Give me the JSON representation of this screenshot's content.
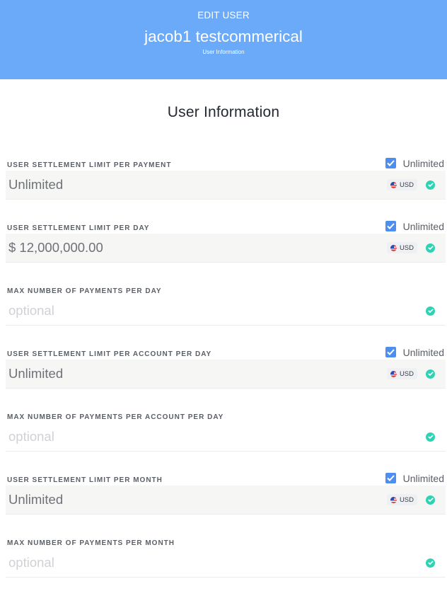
{
  "header": {
    "kicker": "EDIT USER",
    "name": "jacob1 testcommerical",
    "subtitle": "User Information"
  },
  "section_title": "User Information",
  "unlimited_label": "Unlimited",
  "currency_label": "USD",
  "fields": [
    {
      "label": "USER SETTLEMENT LIMIT PER PAYMENT",
      "value": "Unlimited",
      "placeholder": "",
      "has_unlimited": true,
      "unlimited_checked": true,
      "has_currency": true
    },
    {
      "label": "USER SETTLEMENT LIMIT PER DAY",
      "value": "$ 12,000,000.00",
      "placeholder": "",
      "has_unlimited": true,
      "unlimited_checked": true,
      "has_currency": true
    },
    {
      "label": "MAX NUMBER OF PAYMENTS PER DAY",
      "value": "",
      "placeholder": "optional",
      "has_unlimited": false,
      "has_currency": false
    },
    {
      "label": "USER SETTLEMENT LIMIT PER ACCOUNT PER DAY",
      "value": "Unlimited",
      "placeholder": "",
      "has_unlimited": true,
      "unlimited_checked": true,
      "has_currency": true
    },
    {
      "label": "MAX NUMBER OF PAYMENTS PER ACCOUNT PER DAY",
      "value": "",
      "placeholder": "optional",
      "has_unlimited": false,
      "has_currency": false
    },
    {
      "label": "USER SETTLEMENT LIMIT PER MONTH",
      "value": "Unlimited",
      "placeholder": "",
      "has_unlimited": true,
      "unlimited_checked": true,
      "has_currency": true
    },
    {
      "label": "MAX NUMBER OF PAYMENTS PER MONTH",
      "value": "",
      "placeholder": "optional",
      "has_unlimited": false,
      "has_currency": false
    }
  ],
  "colors": {
    "header_bg": "#6aaaf9",
    "checkbox": "#4d8ef0",
    "valid_check": "#2fd3b3",
    "filled_input_bg": "#f6f6f5"
  },
  "icons": {
    "unlimited_checkbox": "checkbox-checked-icon",
    "currency_flag": "us-flag-icon",
    "valid": "check-circle-icon"
  }
}
